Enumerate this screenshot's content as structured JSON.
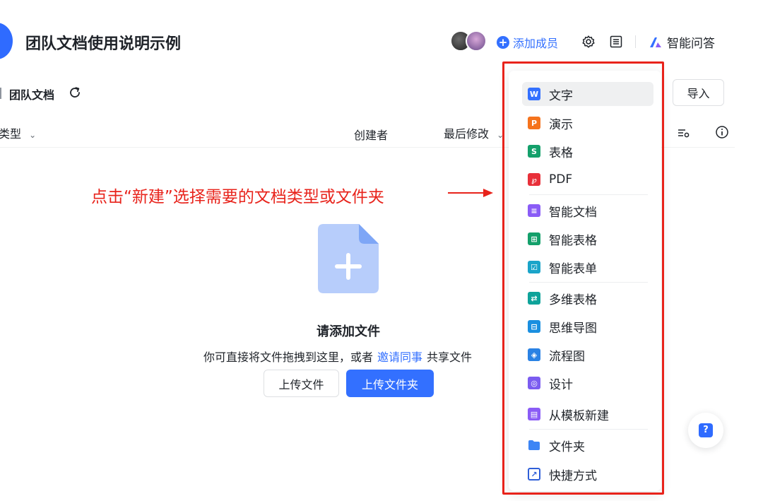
{
  "header": {
    "title": "团队文档使用说明示例",
    "add_member_label": "添加成员",
    "ai_qa_label": "智能问答"
  },
  "breadcrumb": {
    "current": "团队文档"
  },
  "toolbar": {
    "import_label": "导入"
  },
  "columns": {
    "type": "类型",
    "creator": "创建者",
    "modified": "最后修改"
  },
  "annotation": {
    "text": "点击“新建”选择需要的文档类型或文件夹"
  },
  "empty_state": {
    "title": "请添加文件",
    "desc_prefix": "你可直接将文件拖拽到这里，或者",
    "desc_link": "邀请同事",
    "desc_suffix": "共享文件",
    "upload_file_label": "上传文件",
    "upload_folder_label": "上传文件夹"
  },
  "new_menu": {
    "items": [
      {
        "label": "文字",
        "icon": "word-doc-icon",
        "glyph": "W",
        "color": "#3370ff"
      },
      {
        "label": "演示",
        "icon": "presentation-icon",
        "glyph": "P",
        "color": "#f5731d"
      },
      {
        "label": "表格",
        "icon": "sheet-icon",
        "glyph": "S",
        "color": "#14a06b"
      },
      {
        "label": "PDF",
        "icon": "pdf-icon",
        "glyph": "℘",
        "color": "#e8303a"
      },
      {
        "label": "智能文档",
        "icon": "smart-doc-icon",
        "glyph": "≡",
        "color": "#8a5cf6"
      },
      {
        "label": "智能表格",
        "icon": "smart-sheet-icon",
        "glyph": "⊞",
        "color": "#14a06b"
      },
      {
        "label": "智能表单",
        "icon": "smart-form-icon",
        "glyph": "☑",
        "color": "#1aa4c9"
      },
      {
        "label": "多维表格",
        "icon": "multi-table-icon",
        "glyph": "⇄",
        "color": "#0fa39a"
      },
      {
        "label": "思维导图",
        "icon": "mind-map-icon",
        "glyph": "⊟",
        "color": "#1a8fe0"
      },
      {
        "label": "流程图",
        "icon": "flowchart-icon",
        "glyph": "◈",
        "color": "#2a82e4"
      },
      {
        "label": "设计",
        "icon": "design-icon",
        "glyph": "◎",
        "color": "#7b5cf0"
      },
      {
        "label": "从模板新建",
        "icon": "template-icon",
        "glyph": "▤",
        "color": "#8a5cf6"
      },
      {
        "label": "文件夹",
        "icon": "folder-icon",
        "glyph": "",
        "color": "#3d85f5"
      },
      {
        "label": "快捷方式",
        "icon": "shortcut-icon",
        "glyph": "↗",
        "color": "#2f5fd8"
      }
    ]
  }
}
